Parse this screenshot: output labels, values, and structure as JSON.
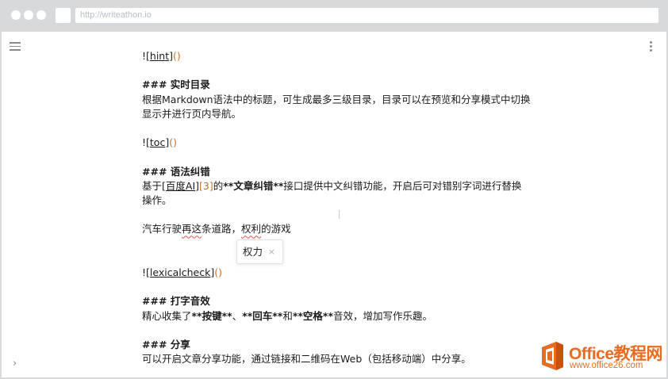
{
  "browser": {
    "url": "http://writeathon.io"
  },
  "editor": {
    "hint_line": {
      "prefix": "![",
      "link": "hint",
      "mid": "]",
      "paren": "()"
    },
    "toc_section": {
      "heading": "### 实时目录",
      "para1": "根据Markdown语法中的标题，可生成最多三级目录，目录可以在预览和分享模式中切换",
      "para2": "显示并进行页内导航。"
    },
    "toc_line": {
      "prefix": "![",
      "link": "toc",
      "mid": "]",
      "paren": "()"
    },
    "grammar_section": {
      "heading": "### 语法纠错",
      "p1_a": "基于[",
      "p1_link": "百度AI",
      "p1_b": "]",
      "p1_ref": "[3]",
      "p1_c": "的",
      "p1_bold": "**文章纠错**",
      "p1_d": "接口提供中文纠错功能，开启后可对错别字词进行替换",
      "p2": "操作。"
    },
    "sample": {
      "a": "汽车行驶",
      "err1": "再这",
      "b": "条道路，",
      "err2": "权利",
      "c": "的游戏"
    },
    "suggestion": {
      "word": "权力",
      "close": "×"
    },
    "lexical_line": {
      "prefix": "![",
      "link": "lexicalcheck",
      "mid": "]",
      "paren": "()"
    },
    "sound_section": {
      "heading": "### 打字音效",
      "a": "精心收集了",
      "b1": "**按键**",
      "c": "、",
      "b2": "**回车**",
      "d": "和",
      "b3": "**空格**",
      "e": "音效，增加写作乐趣。"
    },
    "share_section": {
      "heading": "### 分享",
      "para": "可以开启文章分享功能，通过链接和二维码在Web（包括移动端）中分享。"
    }
  },
  "watermark": {
    "title": "Office教程网",
    "url": "www.office26.com"
  },
  "colors": {
    "accent": "#c0742e",
    "watermark": "#e86b1f",
    "chrome": "#d7dadd"
  }
}
